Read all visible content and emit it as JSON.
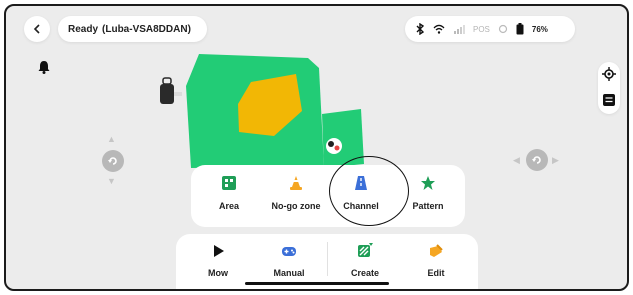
{
  "header": {
    "status": "Ready",
    "device_name": "(Luba-VSA8DDAN)",
    "pos_label": "POS",
    "battery_pct": "76%"
  },
  "create_menu": {
    "items": [
      {
        "label": "Area",
        "icon": "area-grid-icon"
      },
      {
        "label": "No-go zone",
        "icon": "cone-icon"
      },
      {
        "label": "Channel",
        "icon": "channel-road-icon"
      },
      {
        "label": "Pattern",
        "icon": "star-icon"
      }
    ]
  },
  "bottom_bar": {
    "items": [
      {
        "label": "Mow",
        "icon": "play-icon"
      },
      {
        "label": "Manual",
        "icon": "gamepad-icon"
      },
      {
        "label": "Create",
        "icon": "create-pattern-icon"
      },
      {
        "label": "Edit",
        "icon": "edit-icon"
      }
    ]
  },
  "colors": {
    "lawn": "#22cc76",
    "obstacle": "#f2b705",
    "accent_blue": "#3b6fd8",
    "star_green": "#1f9e57",
    "edit_orange": "#f5a623",
    "background": "#ececec"
  }
}
